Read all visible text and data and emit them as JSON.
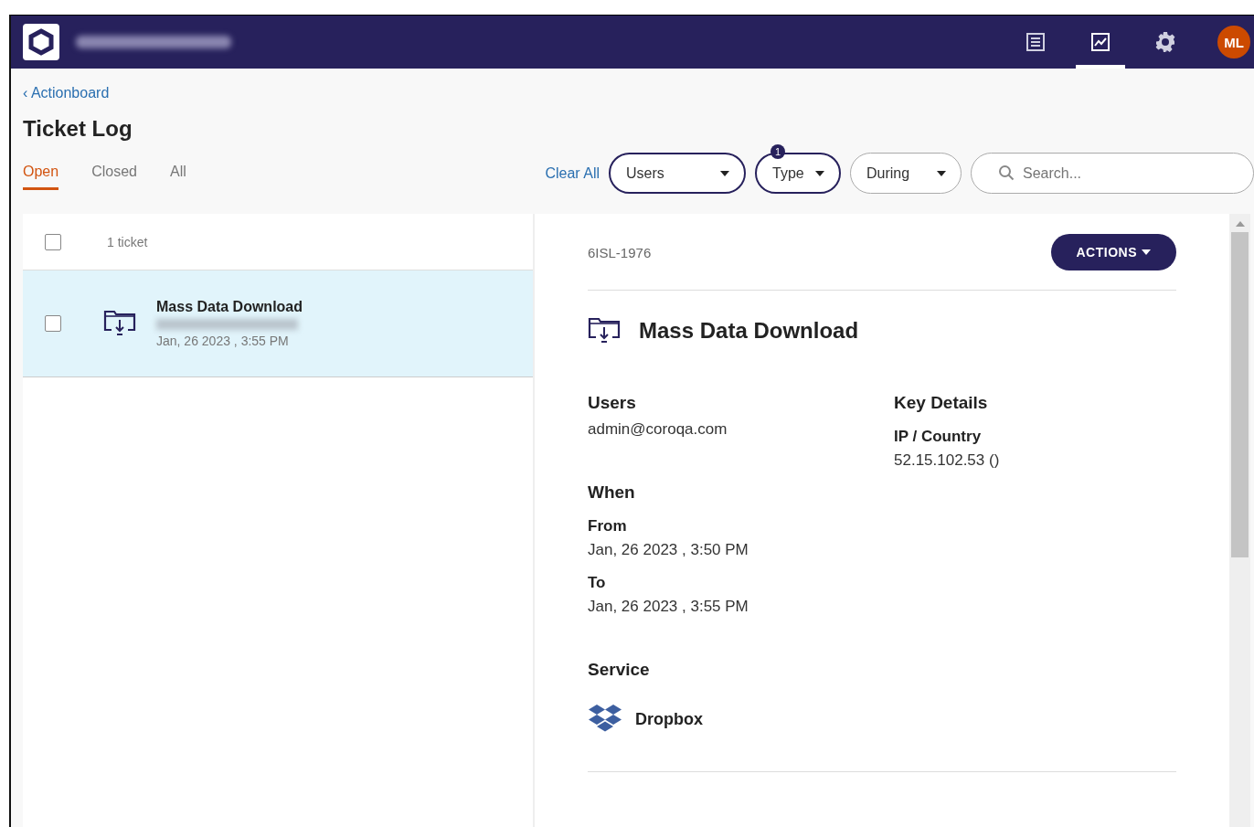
{
  "navbar": {
    "nav_items": [
      {
        "kind": "list",
        "selected": false
      },
      {
        "kind": "chart",
        "selected": true
      },
      {
        "kind": "gear",
        "selected": false
      }
    ],
    "avatar": "ML"
  },
  "breadcrumb": "‹ Actionboard",
  "title": "Ticket Log",
  "tabs": [
    {
      "label": "Open",
      "selected": true
    },
    {
      "label": "Closed",
      "selected": false
    },
    {
      "label": "All",
      "selected": false
    }
  ],
  "clear_all": "Clear All",
  "filters": [
    {
      "label": "Users",
      "active": true
    },
    {
      "label": "Type",
      "active": true,
      "badge": "1"
    },
    {
      "label": "During",
      "active": false
    }
  ],
  "search": {
    "placeholder": "Search..."
  },
  "list": {
    "count": "1 ticket",
    "select_all_checked": false,
    "tickets": [
      {
        "title": "Mass Data Download",
        "date": "Jan, 26 2023 , 3:55 PM",
        "selected": true,
        "checked": false
      }
    ]
  },
  "detail": {
    "id": "6ISL-1976",
    "actions": "ACTIONS",
    "title": "Mass Data Download",
    "users_heading": "Users",
    "user": "admin@coroqa.com",
    "when_heading": "When",
    "from_label": "From",
    "from": "Jan, 26 2023 , 3:50 PM",
    "to_label": "To",
    "to": "Jan, 26 2023 , 3:55 PM",
    "service_heading": "Service",
    "service": "Dropbox",
    "key_details_heading": "Key Details",
    "ip_label": "IP / Country",
    "ip": "52.15.102.53 ()"
  }
}
